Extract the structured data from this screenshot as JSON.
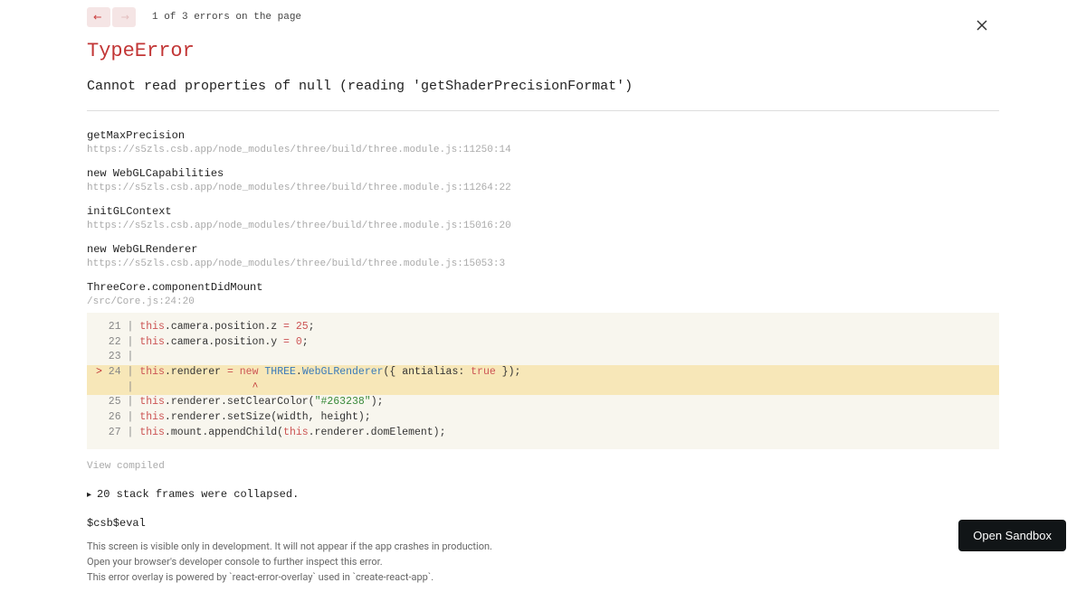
{
  "nav": {
    "status": "1 of 3 errors on the page"
  },
  "error": {
    "type": "TypeError",
    "message": "Cannot read properties of null (reading 'getShaderPrecisionFormat')"
  },
  "frames": [
    {
      "fn": "getMaxPrecision",
      "loc": "https://s5zls.csb.app/node_modules/three/build/three.module.js:11250:14"
    },
    {
      "fn": "new WebGLCapabilities",
      "loc": "https://s5zls.csb.app/node_modules/three/build/three.module.js:11264:22"
    },
    {
      "fn": "initGLContext",
      "loc": "https://s5zls.csb.app/node_modules/three/build/three.module.js:15016:20"
    },
    {
      "fn": "new WebGLRenderer",
      "loc": "https://s5zls.csb.app/node_modules/three/build/three.module.js:15053:3"
    },
    {
      "fn": "ThreeCore.componentDidMount",
      "loc": "/src/Core.js:24:20"
    }
  ],
  "code": {
    "lines": [
      {
        "n": "21",
        "t": "this.camera.position.z = 25;"
      },
      {
        "n": "22",
        "t": "this.camera.position.y = 0;"
      },
      {
        "n": "23",
        "t": ""
      },
      {
        "n": "24",
        "t": "this.renderer = new THREE.WebGLRenderer({ antialias: true });",
        "hl": true
      },
      {
        "n": "",
        "caret": "                  ^"
      },
      {
        "n": "25",
        "t": "this.renderer.setClearColor(\"#263238\");"
      },
      {
        "n": "26",
        "t": "this.renderer.setSize(width, height);"
      },
      {
        "n": "27",
        "t": "this.mount.appendChild(this.renderer.domElement);"
      }
    ]
  },
  "view_compiled": "View compiled",
  "collapsed": "20 stack frames were collapsed.",
  "bottom_frame": "$csb$eval",
  "footer": {
    "l1": "This screen is visible only in development. It will not appear if the app crashes in production.",
    "l2": "Open your browser's developer console to further inspect this error.",
    "l3": "This error overlay is powered by `react-error-overlay` used in `create-react-app`."
  },
  "sandbox_btn": "Open Sandbox"
}
